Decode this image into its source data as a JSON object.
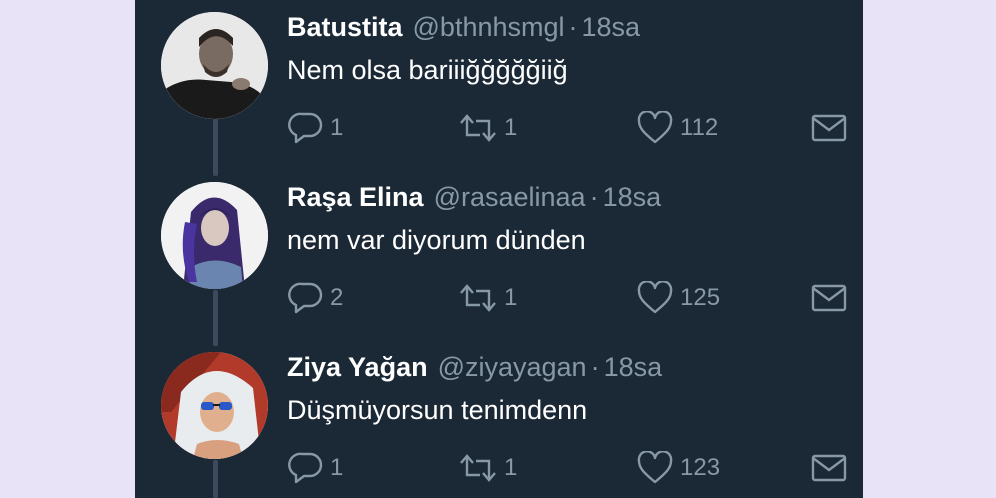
{
  "thread": {
    "replies": [
      {
        "name": "Batustita",
        "handle": "@bthnhsmgl",
        "time": "18sa",
        "text": "Nem olsa bariiiğğğğğiiğ",
        "reply_count": "1",
        "retweet_count": "1",
        "like_count": "112",
        "avatar": "man-with-beard-photo"
      },
      {
        "name": "Raşa Elina",
        "handle": "@rasaelinaa",
        "time": "18sa",
        "text": "nem var diyorum dünden",
        "reply_count": "2",
        "retweet_count": "1",
        "like_count": "125",
        "avatar": "woman-purple-hair-photo"
      },
      {
        "name": "Ziya Yağan",
        "handle": "@ziyayagan",
        "time": "18sa",
        "text": "Düşmüyorsun tenimdenn",
        "reply_count": "1",
        "retweet_count": "1",
        "like_count": "123",
        "avatar": "person-with-sunglasses-photo"
      }
    ]
  },
  "icons": {
    "reply": "reply-icon",
    "retweet": "retweet-icon",
    "like": "heart-icon",
    "dm": "envelope-icon"
  },
  "colors": {
    "background": "#1b2836",
    "page_bg": "#e9e3f7",
    "name": "#ffffff",
    "secondary": "#8899a6",
    "thread_line": "#3b4b5c"
  }
}
